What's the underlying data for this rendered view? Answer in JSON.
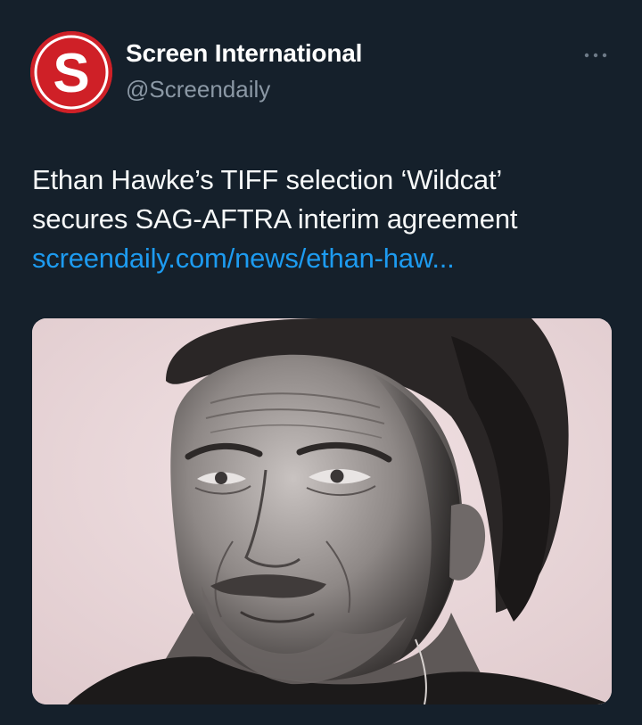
{
  "account": {
    "display_name": "Screen International",
    "handle": "@Screendaily",
    "avatar_letter": "S",
    "avatar_color": "#cf2027"
  },
  "tweet": {
    "text_line1": "Ethan Hawke’s TIFF selection ‘Wildcat’",
    "text_line2": "secures SAG-AFTRA interim agreement",
    "link_text": "screendaily.com/news/ethan-haw..."
  },
  "media": {
    "alt": "Black and white portrait photo of a man"
  },
  "icons": {
    "more": "more-options-icon"
  },
  "colors": {
    "background": "#15202b",
    "link": "#1d9bf0",
    "secondary_text": "#8b98a5"
  }
}
